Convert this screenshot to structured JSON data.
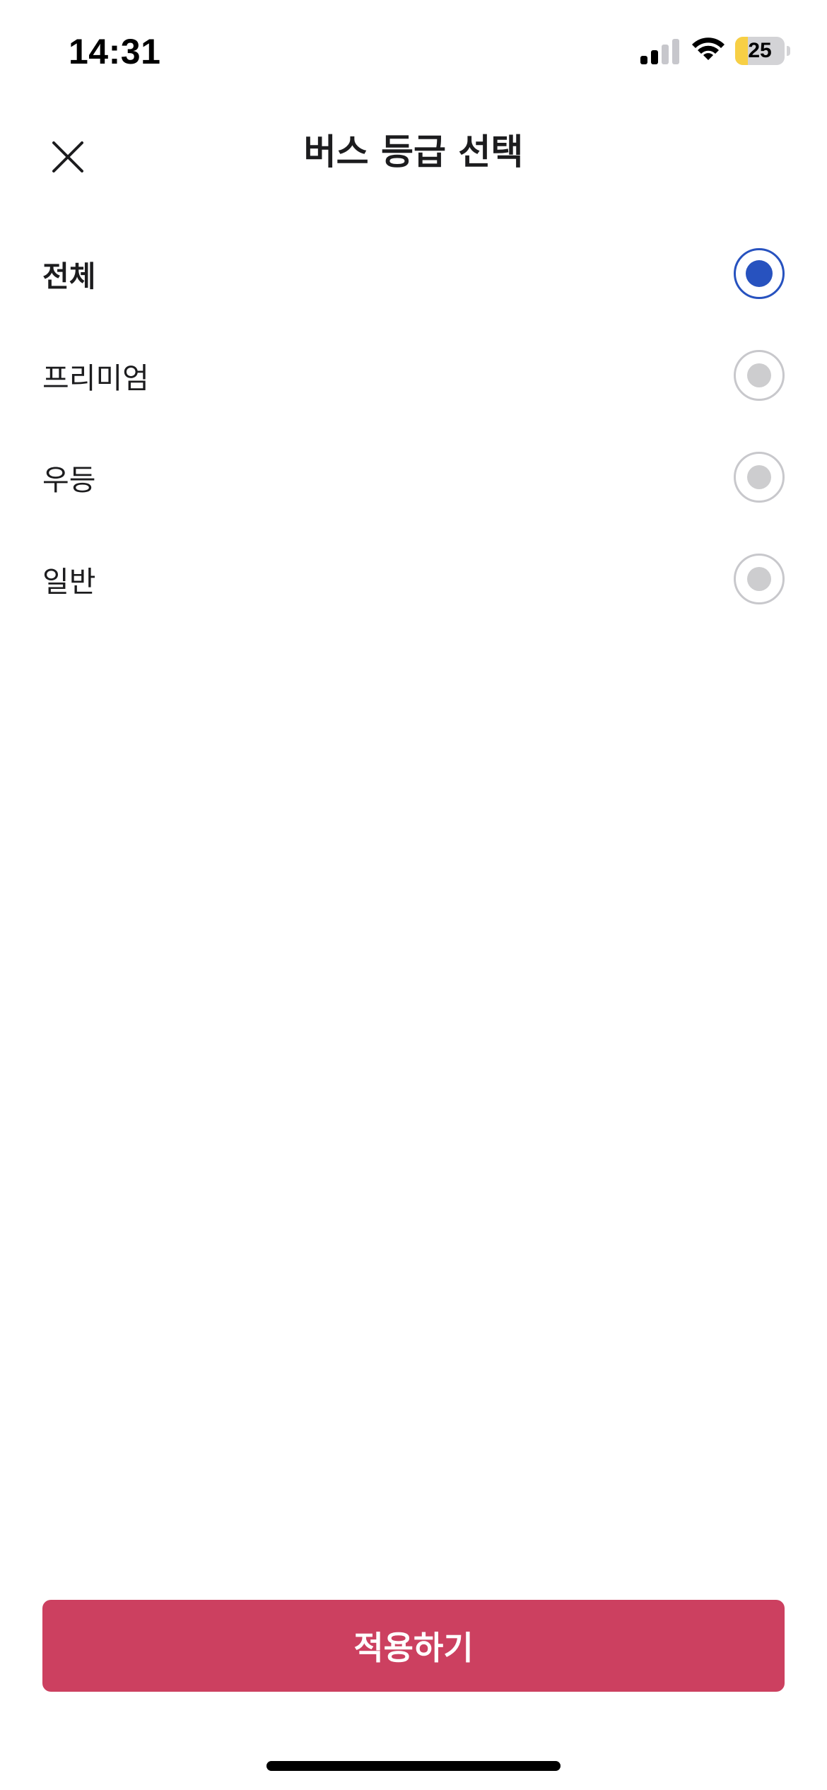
{
  "status_bar": {
    "time": "14:31",
    "battery_level": "25",
    "battery_fraction": 0.25,
    "battery_color": "#f7cf45",
    "signal_bars_active": 2,
    "signal_bars_total": 4,
    "icons": [
      "signal-icon",
      "wifi-icon",
      "battery-icon"
    ]
  },
  "header": {
    "title": "버스 등급 선택",
    "close_icon": "close-icon"
  },
  "options": [
    {
      "label": "전체",
      "selected": true
    },
    {
      "label": "프리미엄",
      "selected": false
    },
    {
      "label": "우등",
      "selected": false
    },
    {
      "label": "일반",
      "selected": false
    }
  ],
  "apply_button": {
    "label": "적용하기"
  },
  "colors": {
    "accent": "#2752bf",
    "primary_button": "#cc4060",
    "radio_inactive": "#cdcdcf"
  }
}
